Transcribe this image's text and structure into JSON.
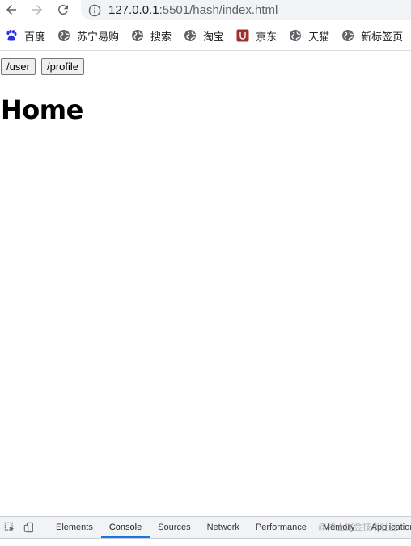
{
  "browser": {
    "url_host": "127.0.0.1",
    "url_rest": ":5501/hash/index.html",
    "back_icon": "arrow-left-icon",
    "forward_icon": "arrow-right-icon",
    "reload_icon": "reload-icon"
  },
  "bookmarks": [
    {
      "label": "百度",
      "icon": "baidu-paw-icon",
      "color": "#2932e1"
    },
    {
      "label": "苏宁易购",
      "icon": "globe-icon",
      "color": "#5f6368"
    },
    {
      "label": "搜索",
      "icon": "globe-icon",
      "color": "#5f6368"
    },
    {
      "label": "淘宝",
      "icon": "globe-icon",
      "color": "#5f6368"
    },
    {
      "label": "京东",
      "icon": "jd-icon",
      "color": "#a0302d"
    },
    {
      "label": "天猫",
      "icon": "globe-icon",
      "color": "#5f6368"
    },
    {
      "label": "新标签页",
      "icon": "globe-icon",
      "color": "#5f6368"
    }
  ],
  "page": {
    "buttons": [
      {
        "label": "/user"
      },
      {
        "label": "/profile"
      }
    ],
    "title": "Home"
  },
  "devtools": {
    "tabs": [
      {
        "label": "Elements"
      },
      {
        "label": "Console"
      },
      {
        "label": "Sources"
      },
      {
        "label": "Network"
      },
      {
        "label": "Performance"
      },
      {
        "label": "Memory"
      },
      {
        "label": "Application"
      }
    ],
    "active_tab": "Console",
    "watermark": "@稀土掘金技术社区"
  }
}
